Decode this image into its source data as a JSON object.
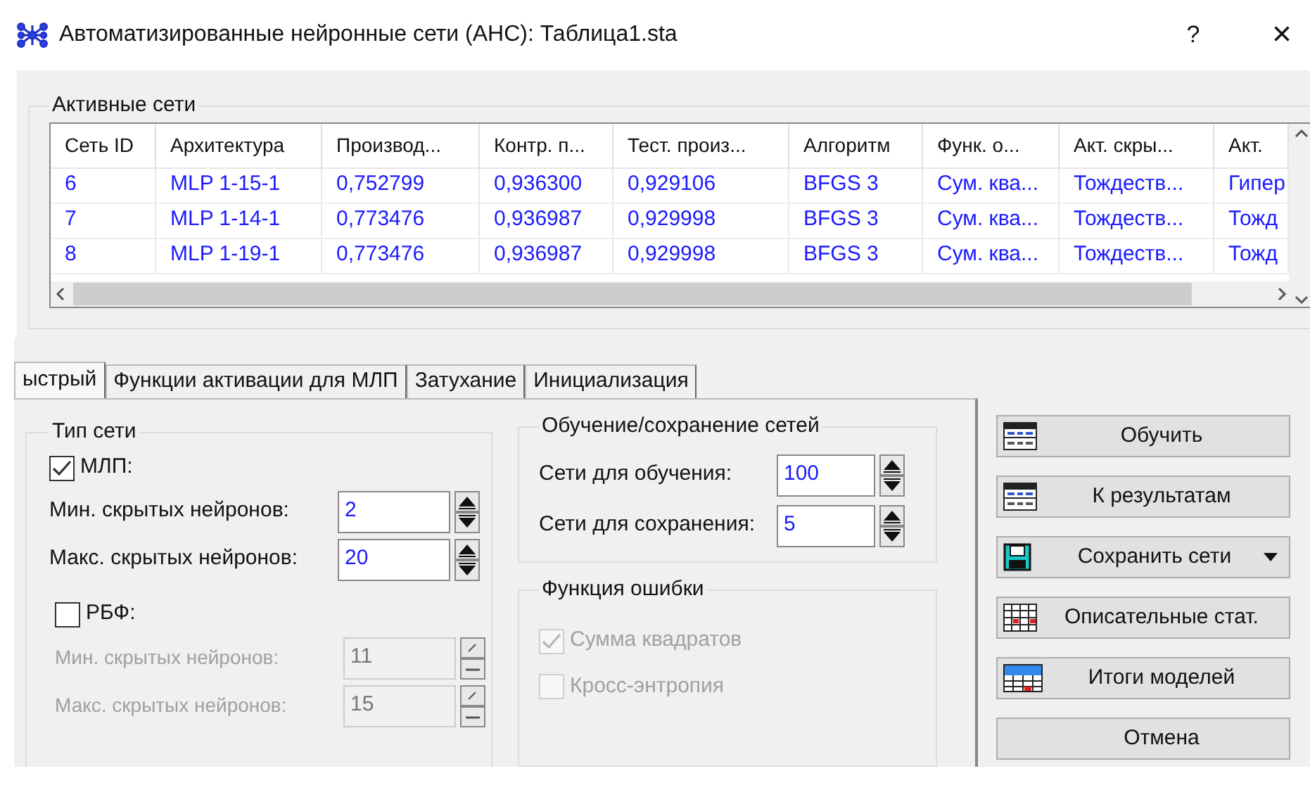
{
  "window": {
    "title": "Автоматизированные нейронные сети (АНС): Таблица1.sta",
    "help": "?",
    "close": "×"
  },
  "active_networks": {
    "label": "Активные сети",
    "columns": [
      "Сеть ID",
      "Архитектура",
      "Производ...",
      "Контр. п...",
      "Тест. произ...",
      "Алгоритм",
      "Функ. о...",
      "Акт. скры...",
      "Акт."
    ],
    "rows": [
      [
        "6",
        "MLP 1-15-1",
        "0,752799",
        "0,936300",
        "0,929106",
        "BFGS 3",
        "Сум. ква...",
        "Тождеств...",
        "Гипер"
      ],
      [
        "7",
        "MLP 1-14-1",
        "0,773476",
        "0,936987",
        "0,929998",
        "BFGS 3",
        "Сум. ква...",
        "Тождеств...",
        "Тожд"
      ],
      [
        "8",
        "MLP 1-19-1",
        "0,773476",
        "0,936987",
        "0,929998",
        "BFGS 3",
        "Сум. ква...",
        "Тождеств...",
        "Тожд"
      ]
    ]
  },
  "tabs": [
    {
      "label": "ыстрый",
      "selected": true
    },
    {
      "label": "Функции активации для МЛП",
      "selected": false
    },
    {
      "label": "Затухание",
      "selected": false
    },
    {
      "label": "Инициализация",
      "selected": false
    }
  ],
  "network_type": {
    "label": "Тип сети",
    "groups": [
      {
        "label": "МЛП:",
        "checked": true,
        "fields": [
          {
            "label": "Мин. скрытых нейронов:",
            "value": "2"
          },
          {
            "label": "Макс. скрытых нейронов:",
            "value": "20"
          }
        ]
      },
      {
        "label": "РБФ:",
        "checked": false,
        "fields": [
          {
            "label": "Мин. скрытых нейронов:",
            "value": "11"
          },
          {
            "label": "Макс. скрытых нейронов:",
            "value": "15"
          }
        ]
      }
    ]
  },
  "training": {
    "label": "Обучение/сохранение сетей",
    "fields": [
      {
        "label": "Сети для обучения:",
        "value": "100"
      },
      {
        "label": "Сети для сохранения:",
        "value": "5"
      }
    ]
  },
  "error_function": {
    "label": "Функция ошибки",
    "disabled": true,
    "options": [
      {
        "label": "Сумма квадратов",
        "checked": true
      },
      {
        "label": "Кросс-энтропия",
        "checked": false
      }
    ]
  },
  "buttons": [
    {
      "label": "Обучить",
      "kind": "table",
      "dropdown": false
    },
    {
      "label": "К результатам",
      "kind": "table",
      "dropdown": false
    },
    {
      "label": "Сохранить сети",
      "kind": "disk",
      "dropdown": true
    },
    {
      "label": "Описательные стат.",
      "kind": "grid",
      "dropdown": false
    },
    {
      "label": "Итоги моделей",
      "kind": "summary",
      "dropdown": false
    },
    {
      "label": "Отмена",
      "kind": "none",
      "dropdown": false
    }
  ]
}
